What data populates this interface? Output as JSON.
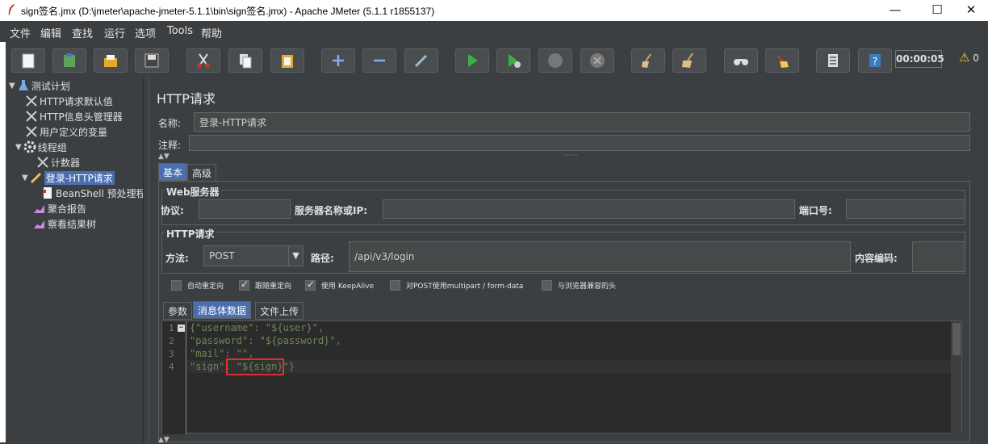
{
  "window": {
    "title": "sign签名.jmx (D:\\jmeter\\apache-jmeter-5.1.1\\bin\\sign签名.jmx) - Apache JMeter (5.1.1 r1855137)",
    "minimize": "—",
    "maximize": "☐",
    "close": "✕"
  },
  "menu": [
    "文件",
    "编辑",
    "查找",
    "运行",
    "选项",
    "Tools",
    "帮助"
  ],
  "toolbar": {
    "buttons": [
      "new-icon",
      "templates-icon",
      "open-icon",
      "save-icon",
      "cut-icon",
      "copy-icon",
      "paste-icon",
      "expand-icon",
      "collapse-icon",
      "toggle-icon",
      "start-icon",
      "start-no-pause-icon",
      "stop-icon",
      "shutdown-icon",
      "clear-icon",
      "clear-all-icon",
      "search-icon",
      "reset-search-icon",
      "function-helper-icon",
      "help-icon"
    ],
    "timer": "00:00:05",
    "warning_count": "0"
  },
  "tree": {
    "items": [
      {
        "label": "测试计划",
        "icon": "test-plan-icon"
      },
      {
        "label": "HTTP请求默认值",
        "icon": "config-icon"
      },
      {
        "label": "HTTP信息头管理器",
        "icon": "config-icon"
      },
      {
        "label": "用户定义的变量",
        "icon": "config-icon"
      },
      {
        "label": "线程组",
        "icon": "gear-icon"
      },
      {
        "label": "计数器",
        "icon": "config-icon"
      },
      {
        "label": "登录-HTTP请求",
        "icon": "sampler-icon"
      },
      {
        "label": "BeanShell 预处理程",
        "icon": "preprocessor-icon"
      },
      {
        "label": "聚合报告",
        "icon": "listener-icon"
      },
      {
        "label": "察看结果树",
        "icon": "listener-icon"
      }
    ]
  },
  "main": {
    "title": "HTTP请求",
    "name_label": "名称:",
    "name_value": "登录-HTTP请求",
    "comment_label": "注释:",
    "tabs": [
      "基本",
      "高级"
    ],
    "web_server": {
      "legend": "Web服务器",
      "protocol_label": "协议:",
      "protocol_value": "",
      "server_label": "服务器名称或IP:",
      "server_value": "",
      "port_label": "端口号:",
      "port_value": ""
    },
    "http_request": {
      "legend": "HTTP请求",
      "method_label": "方法:",
      "method_value": "POST",
      "path_label": "路径:",
      "path_value": "/api/v3/login",
      "encoding_label": "内容编码:",
      "encoding_value": ""
    },
    "checkboxes": [
      {
        "label": "自动重定向",
        "checked": false
      },
      {
        "label": "跟随重定向",
        "checked": true
      },
      {
        "label": "使用 KeepAlive",
        "checked": true
      },
      {
        "label": "对POST使用multipart / form-data",
        "checked": false
      },
      {
        "label": "与浏览器兼容的头",
        "checked": false
      }
    ],
    "sub_tabs": [
      "参数",
      "消息体数据",
      "文件上传"
    ],
    "body_lines": [
      "{\"username\": \"${user}\",",
      "\"password\": \"${password}\",",
      "\"mail\": \"\",",
      "\"sign\": \"${sign}\"}"
    ],
    "line_numbers": [
      "1",
      "2",
      "3",
      "4"
    ]
  }
}
